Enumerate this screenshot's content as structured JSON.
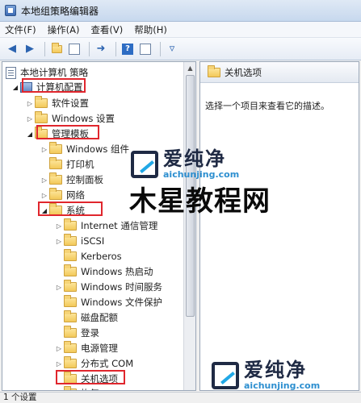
{
  "window": {
    "title": "本地组策略编辑器"
  },
  "menu": [
    "文件(F)",
    "操作(A)",
    "查看(V)",
    "帮助(H)"
  ],
  "tree": {
    "root": "本地计算机 策略",
    "items": [
      {
        "label": "计算机配置",
        "level": 1,
        "expanded": true,
        "icon": "computer-icon"
      },
      {
        "label": "软件设置",
        "level": 2,
        "expanded": false
      },
      {
        "label": "Windows 设置",
        "level": 2,
        "expanded": false
      },
      {
        "label": "管理模板",
        "level": 2,
        "expanded": true
      },
      {
        "label": "Windows 组件",
        "level": 3,
        "expanded": false
      },
      {
        "label": "打印机",
        "level": 3,
        "leaf": true
      },
      {
        "label": "控制面板",
        "level": 3,
        "expanded": false
      },
      {
        "label": "网络",
        "level": 3,
        "expanded": false
      },
      {
        "label": "系统",
        "level": 3,
        "expanded": true
      },
      {
        "label": "Internet 通信管理",
        "level": 4,
        "expanded": false
      },
      {
        "label": "iSCSI",
        "level": 4,
        "expanded": false
      },
      {
        "label": "Kerberos",
        "level": 4,
        "leaf": true
      },
      {
        "label": "Windows 热启动",
        "level": 4,
        "leaf": true
      },
      {
        "label": "Windows 时间服务",
        "level": 4,
        "expanded": false
      },
      {
        "label": "Windows 文件保护",
        "level": 4,
        "leaf": true
      },
      {
        "label": "磁盘配额",
        "level": 4,
        "leaf": true
      },
      {
        "label": "登录",
        "level": 4,
        "leaf": true
      },
      {
        "label": "电源管理",
        "level": 4,
        "expanded": false
      },
      {
        "label": "分布式 COM",
        "level": 4,
        "expanded": false
      },
      {
        "label": "关机选项",
        "level": 4,
        "leaf": true
      },
      {
        "label": "恢复",
        "level": 4,
        "leaf": true
      }
    ]
  },
  "right_pane": {
    "header": "关机选项",
    "description": "选择一个项目来查看它的描述。"
  },
  "status": "1 个设置",
  "watermarks": {
    "logo_cn": "爱纯净",
    "logo_url": "aichunjing.com",
    "overlay_text": "木星教程网"
  }
}
